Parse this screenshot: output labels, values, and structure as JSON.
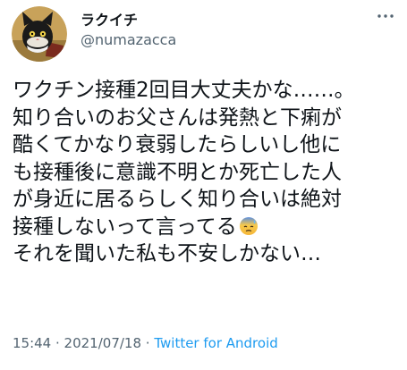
{
  "user": {
    "display_name": "ラクイチ",
    "handle": "@numazacca",
    "avatar_icon": "cat-avatar-icon"
  },
  "header": {
    "more_icon": "more-horizontal-icon"
  },
  "tweet": {
    "lines": [
      "ワクチン接種2回目大丈夫かな……。",
      "知り合いのお父さんは発熱と下痢が",
      "酷くてかなり衰弱したらしいし他に",
      "も接種後に意識不明とか死亡した人",
      "が身近に居るらしく知り合いは絶対",
      "接種しないって言ってる",
      "それを聞いた私も不安しかない…"
    ],
    "emoji_icon": "worried-sweat-face-emoji"
  },
  "meta": {
    "time": "15:44",
    "separator1": " · ",
    "date": "2021/07/18",
    "separator2": " · ",
    "source": "Twitter for Android"
  },
  "colors": {
    "text": "#0f1419",
    "secondary": "#536471",
    "link": "#1d9bf0"
  }
}
